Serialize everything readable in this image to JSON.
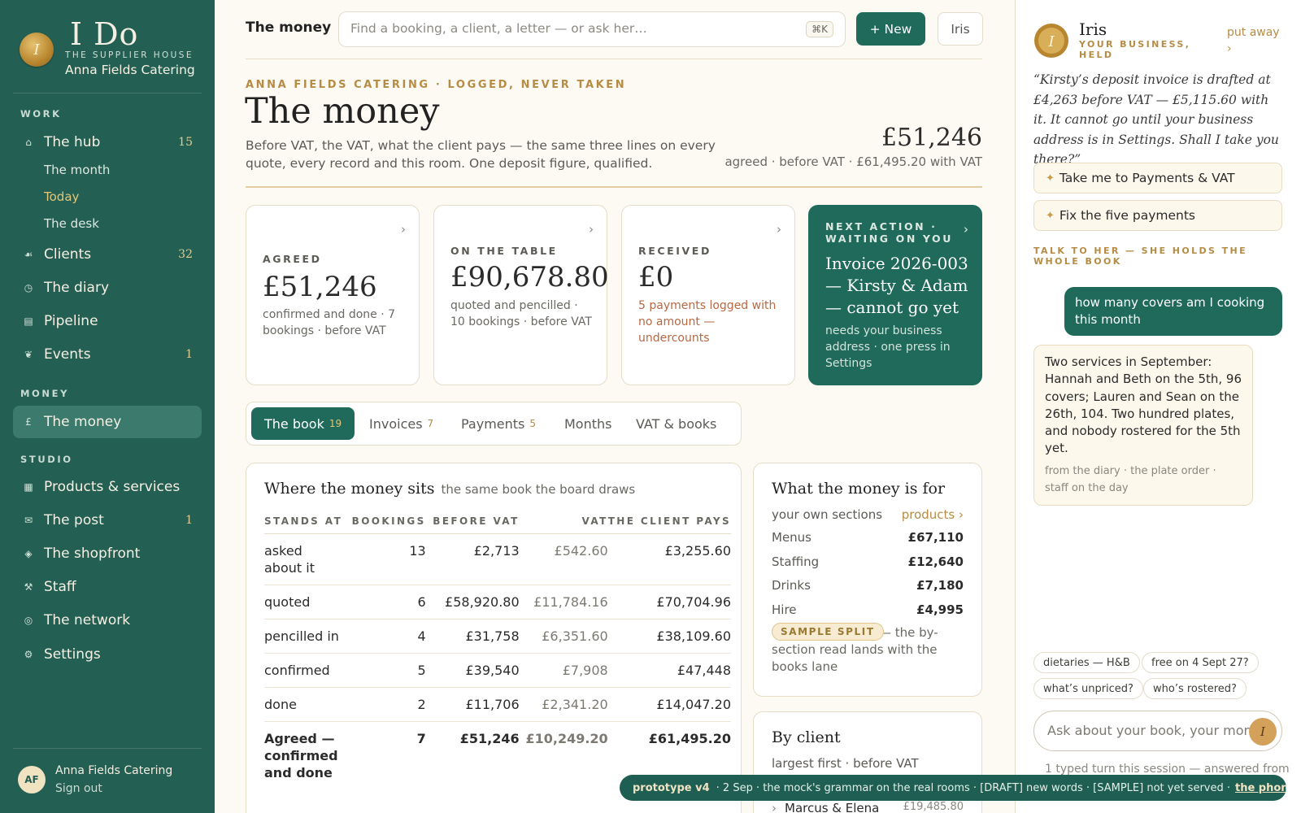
{
  "sidebar": {
    "logo": "I Do",
    "supplier_house": "THE SUPPLIER HOUSE",
    "business_name": "Anna Fields Catering",
    "sections": {
      "work": "WORK",
      "money": "MONEY",
      "studio": "STUDIO"
    },
    "work_items": [
      {
        "label": "The hub",
        "count": "15",
        "icon": "home-icon"
      },
      {
        "label": "Clients",
        "count": "32",
        "icon": "clients-icon"
      },
      {
        "label": "The diary",
        "count": "",
        "icon": "clock-icon"
      },
      {
        "label": "Pipeline",
        "count": "",
        "icon": "pipeline-icon"
      },
      {
        "label": "Events",
        "count": "1",
        "icon": "events-icon"
      }
    ],
    "hub_subitems": [
      "The month",
      "Today",
      "The desk"
    ],
    "money_items": [
      {
        "label": "The money",
        "count": "",
        "icon": "pound-icon"
      }
    ],
    "studio_items": [
      {
        "label": "Products & services",
        "count": "",
        "icon": "grid-icon"
      },
      {
        "label": "The post",
        "count": "1",
        "icon": "mail-icon"
      },
      {
        "label": "The shopfront",
        "count": "",
        "icon": "diamond-icon"
      },
      {
        "label": "Staff",
        "count": "",
        "icon": "tools-icon"
      },
      {
        "label": "The network",
        "count": "",
        "icon": "network-icon"
      },
      {
        "label": "Settings",
        "count": "",
        "icon": "gear-icon"
      }
    ],
    "user": {
      "initials": "AF",
      "name": "Anna Fields Catering",
      "sign_out": "Sign out"
    }
  },
  "topbar": {
    "title": "The money",
    "search_placeholder": "Find a booking, a client, a letter — or ask her…",
    "shortcut": "⌘K",
    "new_label": "+ New",
    "iris_label": "Iris"
  },
  "header": {
    "eyebrow": "ANNA FIELDS CATERING · LOGGED, NEVER TAKEN",
    "title": "The money",
    "intro": "Before VAT, the VAT, what the client pays — the same three lines on every quote, every record and this room. One deposit figure, qualified.",
    "total": "£51,246",
    "total_sub": "agreed · before VAT · £61,495.20 with VAT"
  },
  "cards": {
    "agreed": {
      "label": "AGREED",
      "value": "£51,246",
      "note": "confirmed and done · 7 bookings · before VAT"
    },
    "on_table": {
      "label": "ON THE TABLE",
      "value": "£90,678.80",
      "note": "quoted and pencilled · 10 bookings · before VAT"
    },
    "received": {
      "label": "RECEIVED",
      "value": "£0",
      "note": "5 payments logged with no amount — undercounts"
    },
    "next_action": {
      "label": "NEXT ACTION · WAITING ON YOU",
      "headline": "Invoice 2026-003 — Kirsty & Adam — cannot go yet",
      "note": "needs your business address · one press in Settings"
    }
  },
  "tabs": [
    {
      "label": "The book",
      "count": "19"
    },
    {
      "label": "Invoices",
      "count": "7"
    },
    {
      "label": "Payments",
      "count": "5"
    },
    {
      "label": "Months",
      "count": ""
    },
    {
      "label": "VAT & books",
      "count": ""
    }
  ],
  "book": {
    "title": "Where the money sits",
    "subtitle": "the same book the board draws",
    "columns": [
      "STANDS AT",
      "BOOKINGS",
      "BEFORE VAT",
      "VAT",
      "THE CLIENT PAYS"
    ],
    "rows": [
      {
        "stage": "asked about it",
        "bookings": "13",
        "before_vat": "£2,713",
        "vat": "£542.60",
        "client_pays": "£3,255.60"
      },
      {
        "stage": "quoted",
        "bookings": "6",
        "before_vat": "£58,920.80",
        "vat": "£11,784.16",
        "client_pays": "£70,704.96"
      },
      {
        "stage": "pencilled in",
        "bookings": "4",
        "before_vat": "£31,758",
        "vat": "£6,351.60",
        "client_pays": "£38,109.60"
      },
      {
        "stage": "confirmed",
        "bookings": "5",
        "before_vat": "£39,540",
        "vat": "£7,908",
        "client_pays": "£47,448"
      },
      {
        "stage": "done",
        "bookings": "2",
        "before_vat": "£11,706",
        "vat": "£2,341.20",
        "client_pays": "£14,047.20"
      }
    ],
    "total": {
      "stage": "Agreed — confirmed and done",
      "bookings": "7",
      "before_vat": "£51,246",
      "vat": "£10,249.20",
      "client_pays": "£61,495.20"
    }
  },
  "purpose": {
    "title": "What the money is for",
    "subtitle": "your own sections",
    "link": "products ›",
    "items": [
      {
        "label": "Menus",
        "amount": "£67,110"
      },
      {
        "label": "Staffing",
        "amount": "£12,640"
      },
      {
        "label": "Drinks",
        "amount": "£7,180"
      },
      {
        "label": "Hire",
        "amount": "£4,995"
      }
    ],
    "badge": "SAMPLE SPLIT",
    "note": "— the by-section read lands with the books lane"
  },
  "by_client": {
    "title": "By client",
    "subtitle": "largest first · before VAT",
    "first_client": "Marcus & Elena",
    "first_amount": "£19,485.80"
  },
  "iris": {
    "name": "Iris",
    "tagline": "YOUR BUSINESS, HELD",
    "put_away": "put away ›",
    "quote": "“Kirsty’s deposit invoice is drafted at £4,263 before VAT — £5,115.60 with it. It cannot go until your business address is in Settings. Shall I take you there?”",
    "actions": [
      "Take me to Payments & VAT",
      "Fix the five payments"
    ],
    "talk_label": "TALK TO HER — SHE HOLDS THE WHOLE BOOK",
    "user_message": "how many covers am I cooking this month",
    "reply": "Two services in September: Hannah and Beth on the 5th, 96 covers; Lauren and Sean on the 26th, 104. Two hundred plates, and nobody rostered for the 5th yet.",
    "reply_source": "from the diary · the plate order · staff on the day",
    "chips": [
      "dietaries — H&B",
      "free on 4 Sept 27?",
      "what’s unpriced?",
      "who’s rostered?"
    ],
    "input_placeholder": "Ask about your book, your month",
    "send_label": "I",
    "footer": "1 typed turn this session — answered from"
  },
  "banner": {
    "tag": "prototype v4",
    "text": "· 2 Sep · the mock's grammar on the real rooms · [DRAFT] new words · [SAMPLE] not yet served ·",
    "link": "the phone ›"
  },
  "colors": {
    "sidebar": "#245f54",
    "accent": "#1f6a5b",
    "gold": "#b68c45",
    "warning": "#b96843",
    "page": "#fdfaf3"
  }
}
